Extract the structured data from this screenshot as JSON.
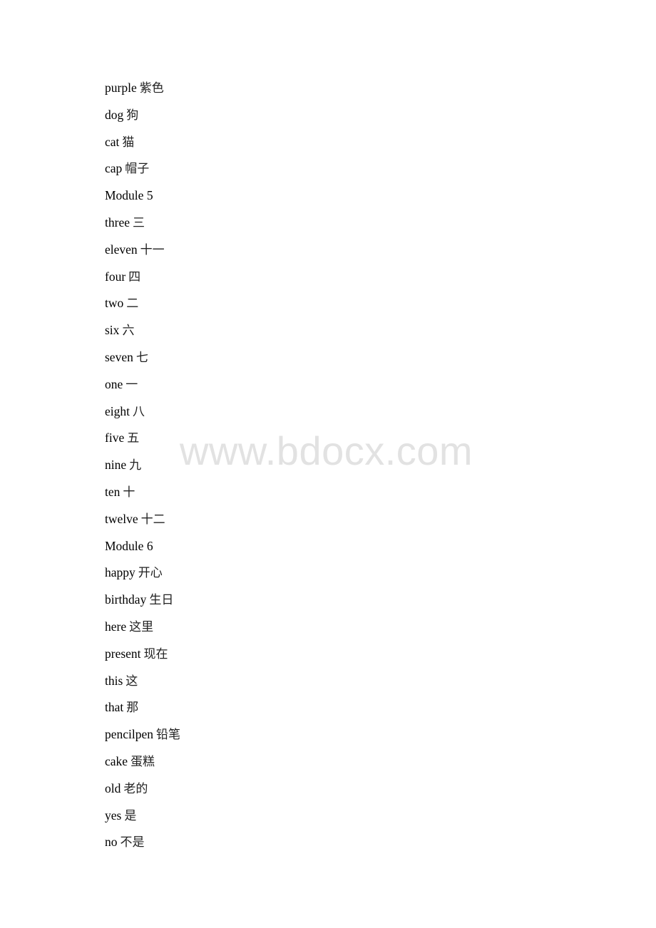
{
  "document": {
    "lines": [
      {
        "en": "purple",
        "zh": "紫色"
      },
      {
        "en": "dog",
        "zh": "狗"
      },
      {
        "en": "cat",
        "zh": "猫"
      },
      {
        "en": "cap",
        "zh": "帽子"
      },
      {
        "en": "Module 5",
        "zh": ""
      },
      {
        "en": "three",
        "zh": "三"
      },
      {
        "en": "eleven",
        "zh": "十一"
      },
      {
        "en": "four",
        "zh": "四"
      },
      {
        "en": "two",
        "zh": "二"
      },
      {
        "en": "six",
        "zh": "六"
      },
      {
        "en": "seven",
        "zh": "七"
      },
      {
        "en": "one",
        "zh": "一"
      },
      {
        "en": "eight",
        "zh": "八"
      },
      {
        "en": "five",
        "zh": "五"
      },
      {
        "en": "nine",
        "zh": "九"
      },
      {
        "en": "ten",
        "zh": "十"
      },
      {
        "en": "twelve",
        "zh": "十二"
      },
      {
        "en": "Module 6",
        "zh": ""
      },
      {
        "en": "happy",
        "zh": "开心"
      },
      {
        "en": "birthday",
        "zh": "生日"
      },
      {
        "en": "here",
        "zh": "这里"
      },
      {
        "en": "present",
        "zh": "现在"
      },
      {
        "en": "this",
        "zh": "这"
      },
      {
        "en": "that",
        "zh": "那"
      },
      {
        "en": "pencilpen",
        "zh": "铅笔"
      },
      {
        "en": "cake",
        "zh": "蛋糕"
      },
      {
        "en": "old",
        "zh": "老的"
      },
      {
        "en": "yes",
        "zh": "是"
      },
      {
        "en": "no",
        "zh": "不是"
      }
    ]
  },
  "watermark": {
    "text": "www.bdocx.com"
  }
}
